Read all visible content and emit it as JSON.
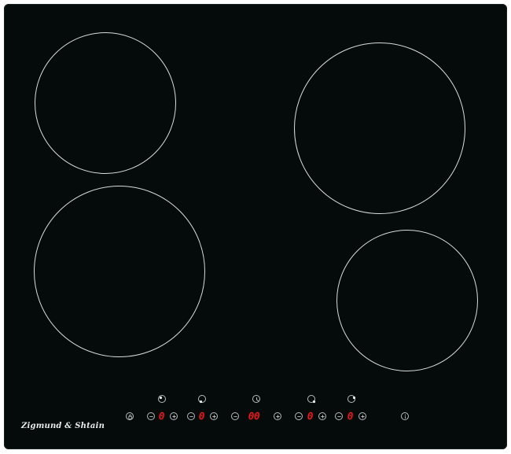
{
  "appliance": {
    "brand": "Zigmund & Shtain"
  },
  "controls": {
    "zone_top_left": {
      "level": "0"
    },
    "zone_bottom_left": {
      "level": "0"
    },
    "timer": {
      "value": "00"
    },
    "zone_bottom_right": {
      "level": "0"
    },
    "zone_top_right": {
      "level": "0"
    }
  },
  "icons": {
    "lock": "lock-icon",
    "timer": "clock-icon",
    "info": "info-icon",
    "minus": "minus-icon",
    "plus": "plus-icon"
  },
  "colors": {
    "glass": "#050a0b",
    "ring": "#d9dcdc",
    "display": "#ff2020"
  }
}
